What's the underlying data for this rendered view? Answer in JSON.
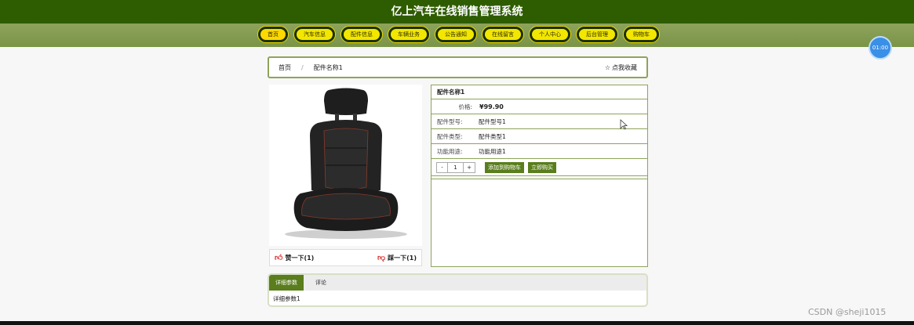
{
  "app_title": "亿上汽车在线销售管理系统",
  "nav": [
    {
      "label": "首页"
    },
    {
      "label": "汽车信息"
    },
    {
      "label": "配件信息"
    },
    {
      "label": "车辆业务"
    },
    {
      "label": "公告通知"
    },
    {
      "label": "在线留言"
    },
    {
      "label": "个人中心"
    },
    {
      "label": "后台管理"
    },
    {
      "label": "购物车"
    }
  ],
  "timer": "01:00",
  "breadcrumb": {
    "home": "首页",
    "sep": "/",
    "current": "配件名称1",
    "favorite": "点我收藏"
  },
  "product": {
    "name": "配件名称1",
    "price_label": "价格:",
    "price": "¥99.90",
    "fields": [
      {
        "label": "配件型号:",
        "value": "配件型号1"
      },
      {
        "label": "配件类型:",
        "value": "配件类型1"
      },
      {
        "label": "功能用途:",
        "value": "功能用途1"
      }
    ],
    "qty": {
      "minus": "-",
      "value": "1",
      "plus": "+"
    },
    "add_cart": "添加到购物车",
    "buy_now": "立即购买"
  },
  "likes": {
    "like": "赞一下(1)",
    "dislike": "踩一下(1)"
  },
  "tabs": [
    {
      "label": "详细参数"
    },
    {
      "label": "评论"
    }
  ],
  "tab_content": "详细参数1",
  "watermark": "CSDN @sheji1015",
  "colors": {
    "header": "#2e5c00",
    "nav": "#8ea35b",
    "button": "#5a7d1d",
    "nav_pill": "#f3e600"
  }
}
